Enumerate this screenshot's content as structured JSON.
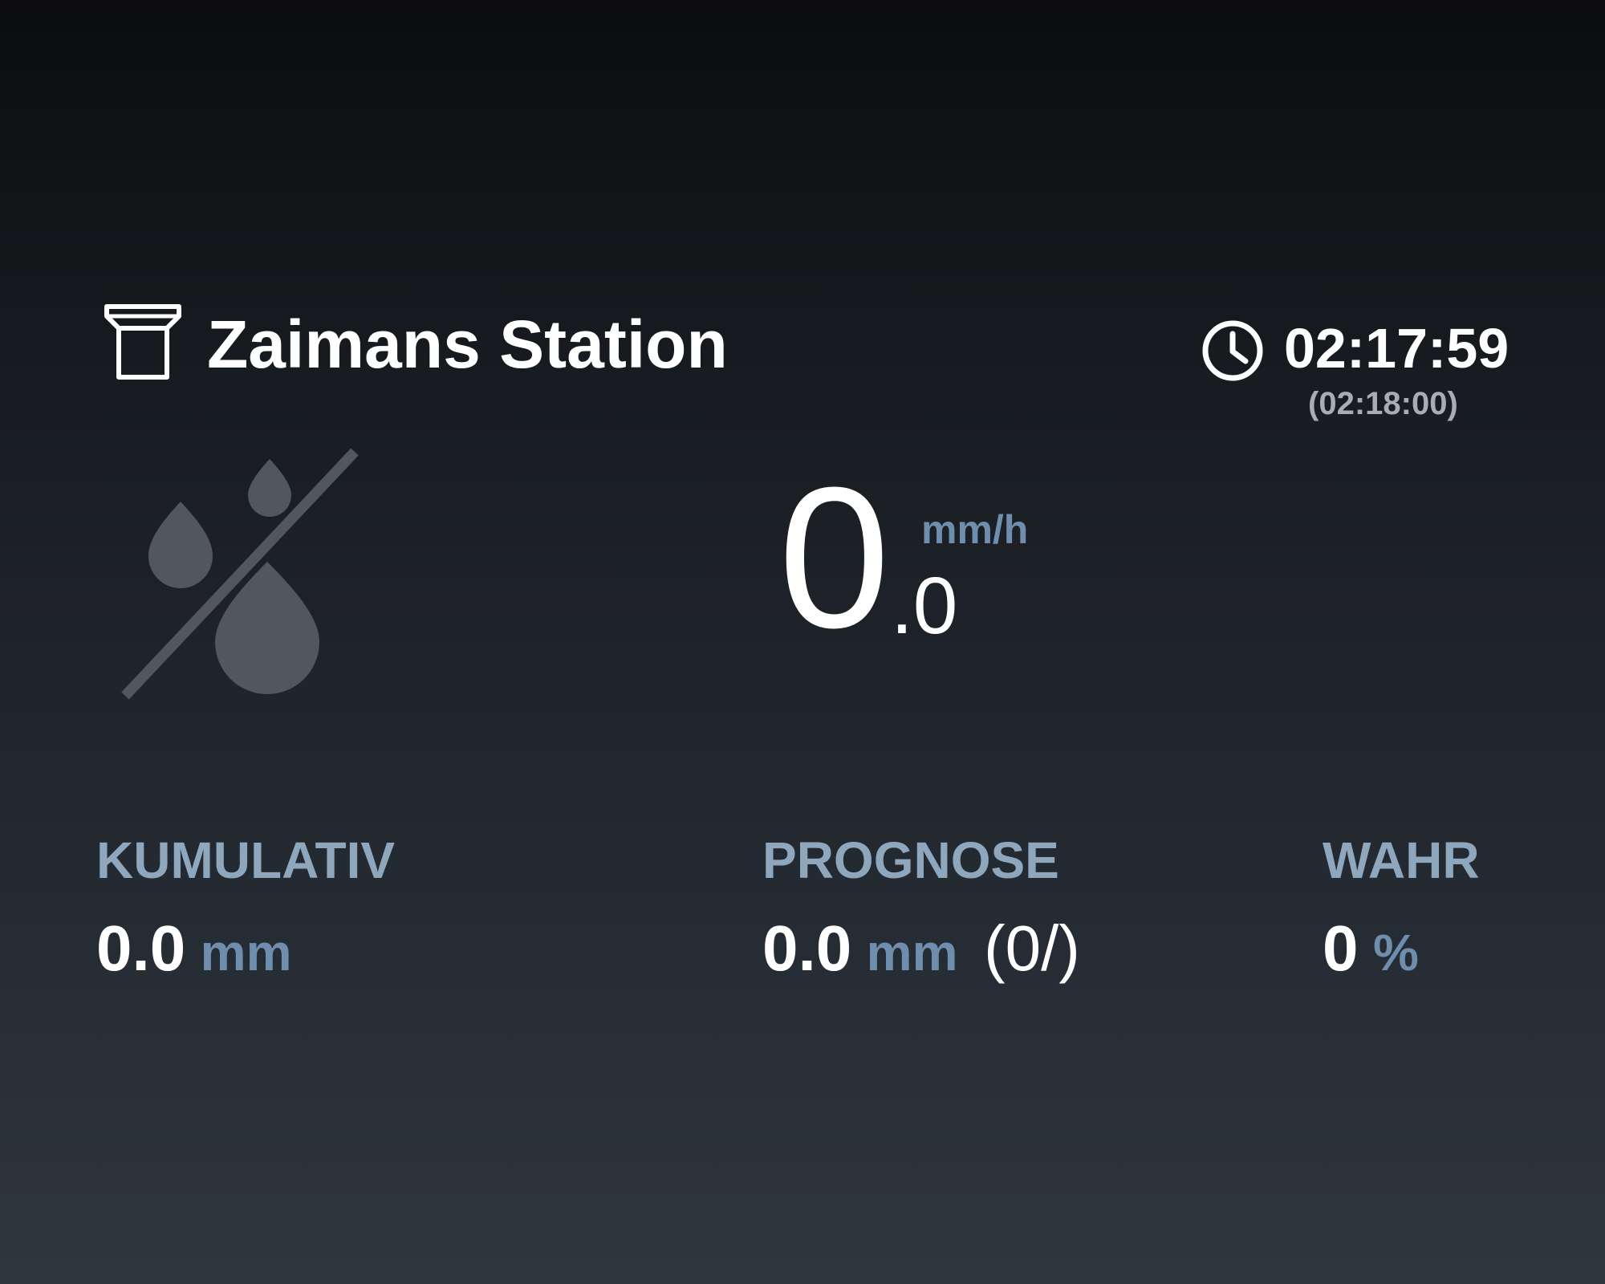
{
  "header": {
    "station_name": "Zaimans Station",
    "station_icon": "rain-gauge-icon",
    "clock_icon": "clock-icon",
    "time": "02:17:59",
    "time_reference": "(02:18:00)"
  },
  "current": {
    "status_icon": "no-rain-icon",
    "rate_integer": "0",
    "rate_decimal": ".0",
    "rate_unit": "mm/h"
  },
  "stats": {
    "cumulative": {
      "label": "KUMULATIV",
      "value": "0.0",
      "unit": "mm"
    },
    "forecast": {
      "label": "PROGNOSE",
      "value": "0.0",
      "unit": "mm",
      "extra": "(0/)"
    },
    "probability": {
      "label": "WAHR",
      "value": "0",
      "unit": "%"
    }
  },
  "colors": {
    "label": "#8fa7bd",
    "unit": "#6f8ead",
    "icon_muted": "#52575d",
    "text": "#ffffff"
  }
}
